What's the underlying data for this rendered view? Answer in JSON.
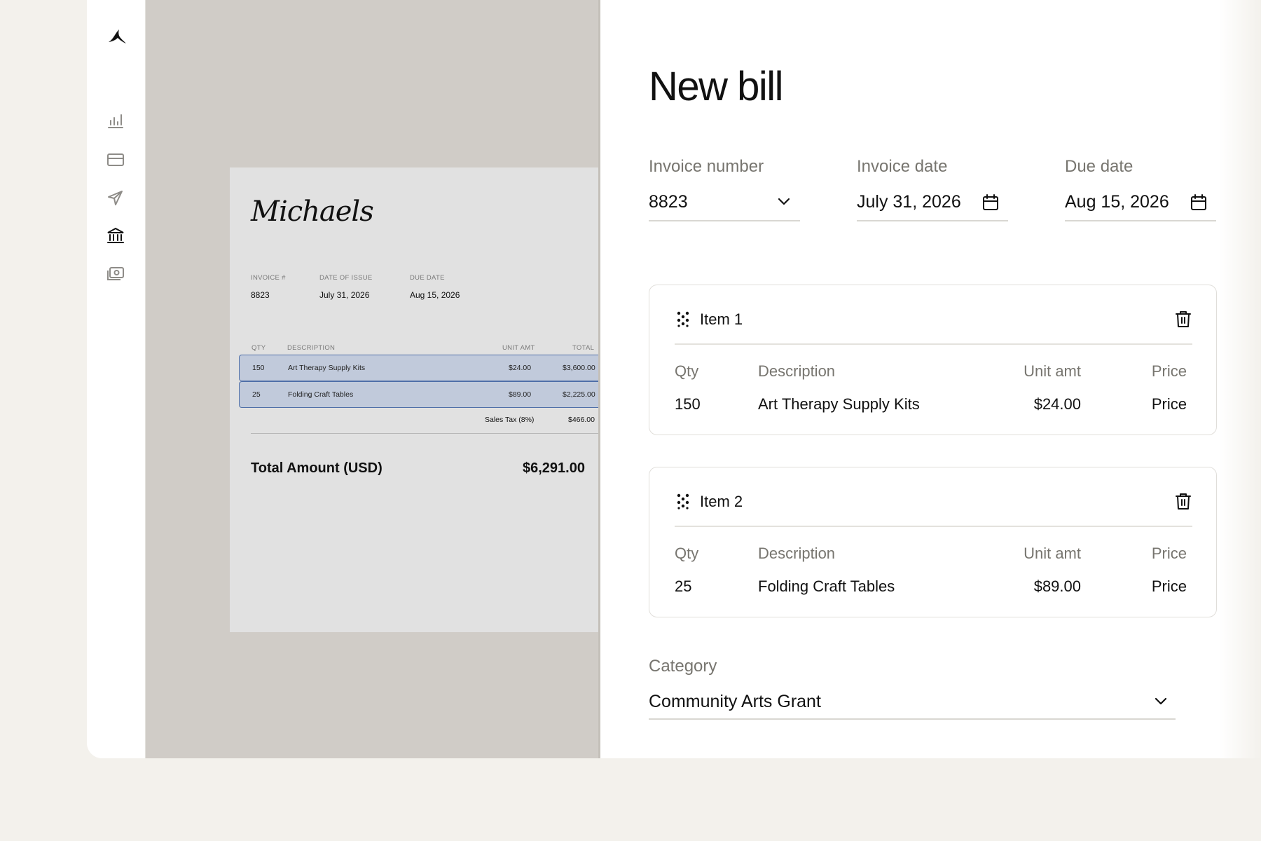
{
  "invoice_preview": {
    "brand": "Michaels",
    "meta": [
      {
        "label": "INVOICE #",
        "value": "8823"
      },
      {
        "label": "DATE OF ISSUE",
        "value": "July 31, 2026"
      },
      {
        "label": "DUE DATE",
        "value": "Aug 15, 2026"
      }
    ],
    "headers": {
      "qty": "QTY",
      "description": "DESCRIPTION",
      "unit_amt": "UNIT AMT",
      "total": "TOTAL"
    },
    "rows": [
      {
        "qty": "150",
        "description": "Art Therapy Supply Kits",
        "unit_amt": "$24.00",
        "total": "$3,600.00"
      },
      {
        "qty": "25",
        "description": "Folding Craft Tables",
        "unit_amt": "$89.00",
        "total": "$2,225.00"
      }
    ],
    "tax_label": "Sales Tax (8%)",
    "tax_value": "$466.00",
    "total_label": "Total Amount (USD)",
    "total_value": "$6,291.00",
    "highlight_color": "#c1cadb",
    "highlight_border": "#4f6fa8"
  },
  "form": {
    "title": "New bill",
    "invoice_number": {
      "label": "Invoice number",
      "value": "8823"
    },
    "invoice_date": {
      "label": "Invoice date",
      "value": "July 31, 2026"
    },
    "due_date": {
      "label": "Due date",
      "value": "Aug 15, 2026"
    },
    "column_headers": {
      "qty": "Qty",
      "description": "Description",
      "unit_amt": "Unit amt",
      "price": "Price"
    },
    "items": [
      {
        "title": "Item 1",
        "qty": "150",
        "description": "Art Therapy Supply Kits",
        "unit_amt": "$24.00",
        "price": "Price"
      },
      {
        "title": "Item 2",
        "qty": "25",
        "description": "Folding Craft Tables",
        "unit_amt": "$89.00",
        "price": "Price"
      }
    ],
    "category": {
      "label": "Category",
      "value": "Community Arts Grant"
    }
  },
  "sidebar": {
    "icons": [
      "logo-icon",
      "chart-icon",
      "card-icon",
      "plane-icon",
      "bank-icon",
      "cash-icon"
    ]
  }
}
